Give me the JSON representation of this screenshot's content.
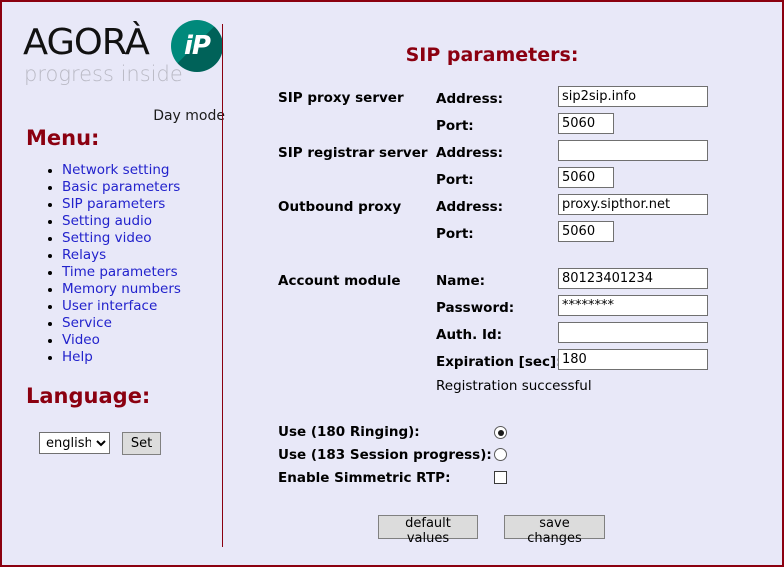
{
  "branding": {
    "logo_word": "AGORÀ",
    "logo_tagline": "progress inside",
    "badge_text": "iP",
    "mode_label": "Day mode",
    "accent_color": "#8b0010",
    "badge_color": "#00897b",
    "page_background": "#e8e8f8",
    "link_color": "#2222cc"
  },
  "sidebar": {
    "menu_title": "Menu:",
    "items": [
      {
        "label": "Network setting"
      },
      {
        "label": "Basic parameters"
      },
      {
        "label": "SIP parameters"
      },
      {
        "label": "Setting audio"
      },
      {
        "label": "Setting video"
      },
      {
        "label": "Relays"
      },
      {
        "label": "Time parameters"
      },
      {
        "label": "Memory numbers"
      },
      {
        "label": "User interface"
      },
      {
        "label": "Service"
      },
      {
        "label": "Video"
      },
      {
        "label": "Help"
      }
    ],
    "language_title": "Language:",
    "language_selected": "english",
    "language_options": [
      "english"
    ],
    "set_button_label": "Set"
  },
  "main": {
    "title": "SIP parameters:",
    "groups": {
      "sip_proxy_server": {
        "label": "SIP proxy server",
        "address_label": "Address:",
        "address_value": "sip2sip.info",
        "port_label": "Port:",
        "port_value": "5060"
      },
      "sip_registrar_server": {
        "label": "SIP registrar server",
        "address_label": "Address:",
        "address_value": "",
        "port_label": "Port:",
        "port_value": "5060"
      },
      "outbound_proxy": {
        "label": "Outbound proxy",
        "address_label": "Address:",
        "address_value": "proxy.sipthor.net",
        "port_label": "Port:",
        "port_value": "5060"
      },
      "account_module": {
        "label": "Account module",
        "name_label": "Name:",
        "name_value": "80123401234",
        "password_label": "Password:",
        "password_value": "********",
        "auth_id_label": "Auth. Id:",
        "auth_id_value": "",
        "expiration_label": "Expiration [sec]:",
        "expiration_value": "180",
        "registration_status": "Registration successful"
      }
    },
    "options": {
      "ringing_label": "Use (180 Ringing):",
      "ringing_checked": true,
      "session_progress_label": "Use (183 Session progress):",
      "session_progress_checked": false,
      "symmetric_rtp_label": "Enable Simmetric RTP:",
      "symmetric_rtp_checked": false
    },
    "buttons": {
      "default_values": "default values",
      "save_changes": "save changes"
    }
  }
}
